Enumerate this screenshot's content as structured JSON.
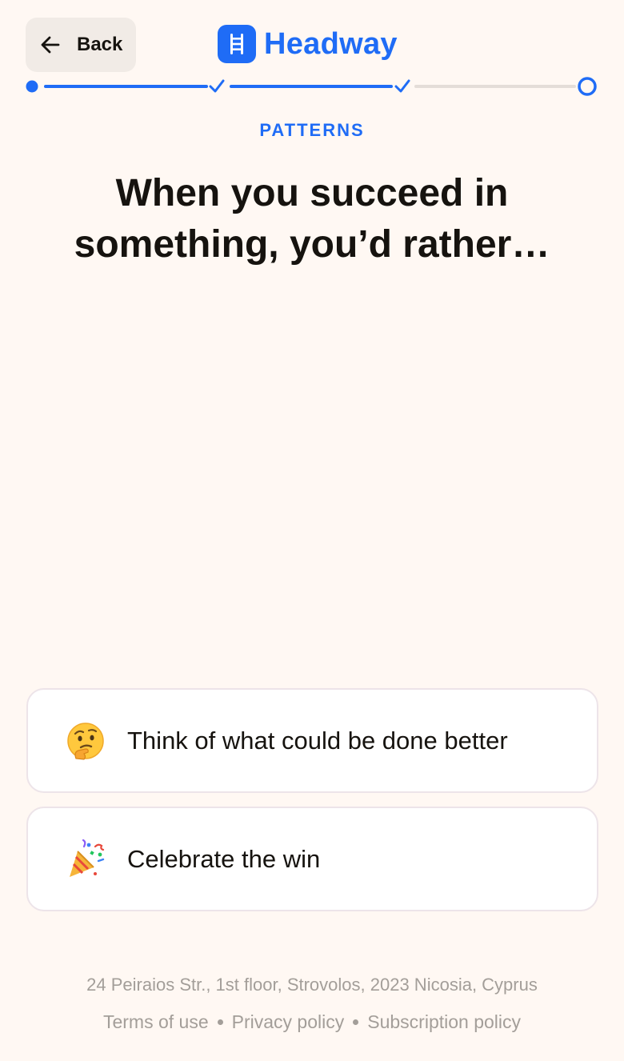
{
  "header": {
    "back_label": "Back",
    "brand_name": "Headway",
    "brand_color": "#1f6cf6"
  },
  "progress": {
    "total_steps": 4,
    "current_step": 4,
    "completed_steps": 3
  },
  "quiz": {
    "category": "PATTERNS",
    "question_line1": "When you succeed in",
    "question_line2": "something, you’d rather…",
    "options": [
      {
        "emoji": "thinking-face",
        "label": "Think of what could be done better"
      },
      {
        "emoji": "party-popper",
        "label": "Celebrate the win"
      }
    ]
  },
  "footer": {
    "address": "24 Peiraios Str., 1st floor, Strovolos, 2023 Nicosia, Cyprus",
    "links": [
      "Terms of use",
      "Privacy policy",
      "Subscription policy"
    ]
  }
}
